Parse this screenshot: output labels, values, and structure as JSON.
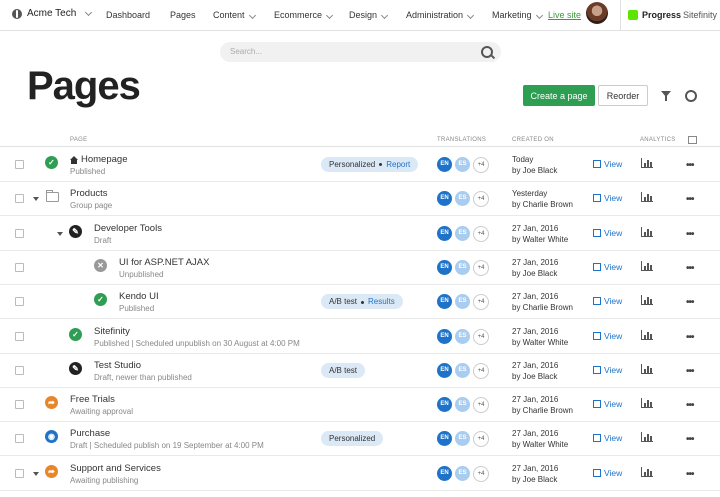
{
  "topbar": {
    "site": "Acme Tech",
    "nav": [
      {
        "label": "Dashboard",
        "dropdown": false
      },
      {
        "label": "Pages",
        "dropdown": false
      },
      {
        "label": "Content",
        "dropdown": true
      },
      {
        "label": "Ecommerce",
        "dropdown": true
      },
      {
        "label": "Design",
        "dropdown": true
      },
      {
        "label": "Administration",
        "dropdown": true
      },
      {
        "label": "Marketing",
        "dropdown": true
      }
    ],
    "live_site": "Live site",
    "brand": "Progress",
    "brand_sub": "Sitefinity"
  },
  "search": {
    "placeholder": "Search..."
  },
  "page_title": "Pages",
  "actions": {
    "create": "Create a page",
    "reorder": "Reorder"
  },
  "columns": {
    "page": "PAGE",
    "translations": "TRANSLATIONS",
    "created_on": "CREATED ON",
    "analytics": "ANALYTICS"
  },
  "colors": {
    "accent": "#2e9e52",
    "link": "#1e73c9",
    "approval": "#e8862a"
  },
  "rows": [
    {
      "name": "Homepage",
      "sub": "Published",
      "level": 0,
      "status": "published",
      "icon": "home",
      "expand": false,
      "tag": {
        "text": "Personalized",
        "link": "Report"
      },
      "langs": [
        "EN",
        "ES",
        "+4"
      ],
      "date": "Today",
      "by": "by Joe Black",
      "view": "View"
    },
    {
      "name": "Products",
      "sub": "Group page",
      "level": 0,
      "status": "folder",
      "expand": true,
      "tag": null,
      "langs": [
        "EN",
        "ES",
        "+4"
      ],
      "date": "Yesterday",
      "by": "by Charlie Brown",
      "view": "View"
    },
    {
      "name": "Developer Tools",
      "sub": "Draft",
      "level": 1,
      "status": "draft",
      "expand": true,
      "tag": null,
      "langs": [
        "EN",
        "ES",
        "+4"
      ],
      "date": "27 Jan, 2016",
      "by": "by Walter White",
      "view": "View"
    },
    {
      "name": "UI for ASP.NET AJAX",
      "sub": "Unpublished",
      "level": 2,
      "status": "unpub",
      "expand": false,
      "tag": null,
      "langs": [
        "EN",
        "ES",
        "+4"
      ],
      "date": "27 Jan, 2016",
      "by": "by Joe Black",
      "view": "View"
    },
    {
      "name": "Kendo UI",
      "sub": "Published",
      "level": 2,
      "status": "published",
      "expand": false,
      "tag": {
        "text": "A/B test",
        "link": "Results"
      },
      "langs": [
        "EN",
        "ES",
        "+4"
      ],
      "date": "27 Jan, 2016",
      "by": "by Charlie Brown",
      "view": "View"
    },
    {
      "name": "Sitefinity",
      "sub": "Published | Scheduled unpublish on 30 August at 4:00 PM",
      "level": 1,
      "status": "published",
      "expand": false,
      "tag": null,
      "langs": [
        "EN",
        "ES",
        "+4"
      ],
      "date": "27 Jan, 2016",
      "by": "by Walter White",
      "view": "View"
    },
    {
      "name": "Test Studio",
      "sub": "Draft, newer than published",
      "level": 1,
      "status": "draft",
      "expand": false,
      "tag": {
        "text": "A/B test",
        "link": ""
      },
      "langs": [
        "EN",
        "ES",
        "+4"
      ],
      "date": "27 Jan, 2016",
      "by": "by Joe Black",
      "view": "View"
    },
    {
      "name": "Free Trials",
      "sub": "Awaiting approval",
      "level": 0,
      "status": "approval",
      "expand": false,
      "tag": null,
      "langs": [
        "EN",
        "ES",
        "+4"
      ],
      "date": "27 Jan, 2016",
      "by": "by Charlie Brown",
      "view": "View"
    },
    {
      "name": "Purchase",
      "sub": "Draft | Scheduled publish on 19 September at 4:00 PM",
      "level": 0,
      "status": "scheduled",
      "expand": false,
      "tag": {
        "text": "Personalized",
        "link": ""
      },
      "langs": [
        "EN",
        "ES",
        "+4"
      ],
      "date": "27 Jan, 2016",
      "by": "by Walter White",
      "view": "View"
    },
    {
      "name": "Support and Services",
      "sub": "Awaiting publishing",
      "level": 0,
      "status": "approval",
      "expand": true,
      "tag": null,
      "langs": [
        "EN",
        "ES",
        "+4"
      ],
      "date": "27 Jan, 2016",
      "by": "by Joe Black",
      "view": "View"
    }
  ]
}
